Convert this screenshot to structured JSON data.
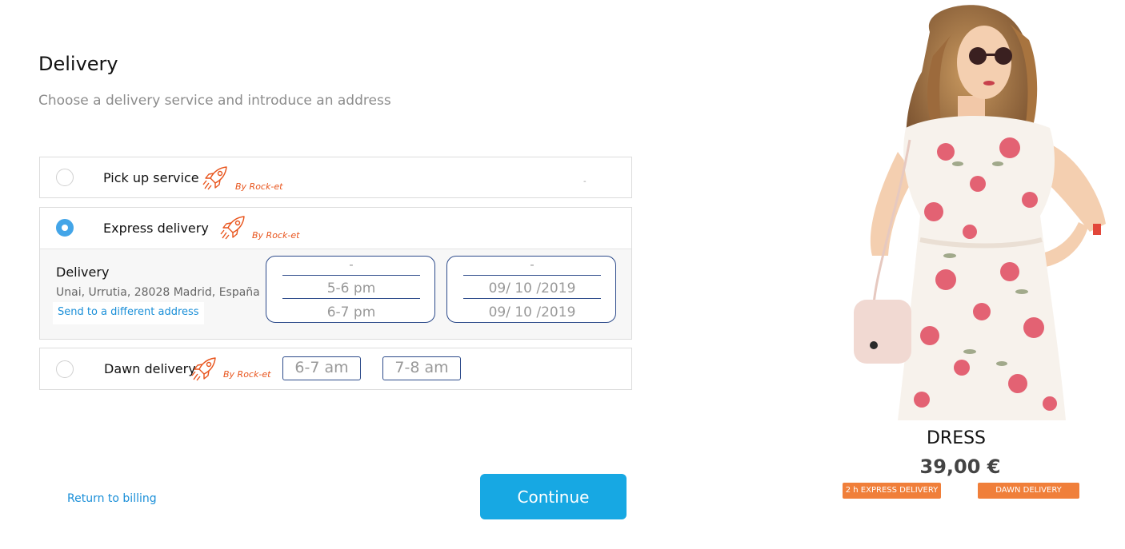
{
  "page": {
    "title": "Delivery",
    "subtitle": "Choose a delivery service and introduce an address"
  },
  "options": {
    "pickup": {
      "label": "Pick up service",
      "by": "By Rock-et",
      "selected": false,
      "mark": "-"
    },
    "express": {
      "label": "Express delivery",
      "by": "By Rock-et",
      "selected": true,
      "details": {
        "title": "Delivery",
        "address": "Unai, Urrutia, 28028 Madrid, España",
        "change_link": "Send to a different address"
      },
      "time_picker": [
        "-",
        "5-6 pm",
        "6-7 pm"
      ],
      "date_picker": [
        "-",
        "09/ 10 /2019",
        "09/ 10 /2019"
      ]
    },
    "dawn": {
      "label": "Dawn delivery",
      "by": "By Rock-et",
      "selected": false,
      "slots": [
        "6-7 am",
        "7-8 am"
      ]
    }
  },
  "footer": {
    "return_link": "Return to billing",
    "continue_label": "Continue"
  },
  "product": {
    "name": "DRESS",
    "price": "39,00 €",
    "badges": [
      "2 h EXPRESS DELIVERY",
      "DAWN DELIVERY"
    ]
  },
  "colors": {
    "accent": "#17a8e3",
    "radio_selected": "#43a5e8",
    "brand_orange": "#e8541c",
    "badge": "#f07f3a",
    "picker_border": "#2c4a8a"
  },
  "icons": {
    "rocket": "rocket-icon"
  }
}
